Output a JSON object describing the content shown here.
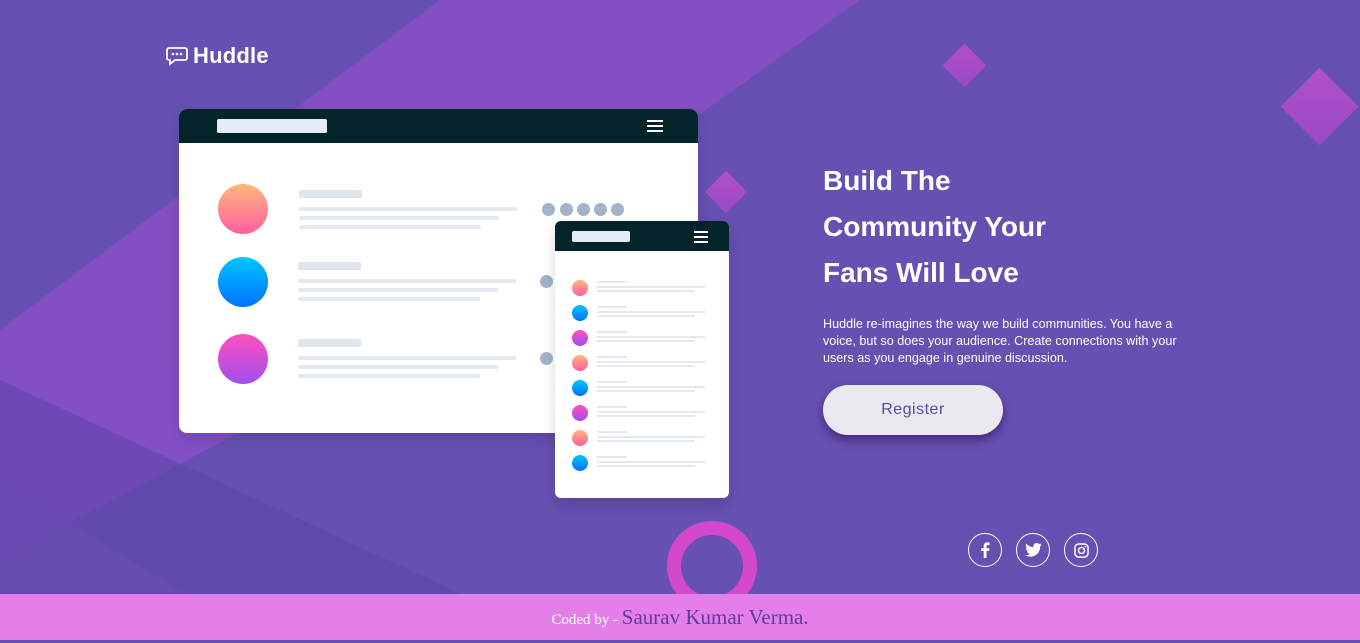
{
  "logo": {
    "text": "Huddle"
  },
  "hero": {
    "headline_lines": [
      "Build The",
      "Community Your",
      "Fans Will Love"
    ],
    "description": "Huddle re-imagines the way we build communities. You have a voice, but so does your audience. Create connections with your users as you engage in genuine discussion.",
    "register_label": "Register"
  },
  "social": [
    {
      "name": "facebook-icon"
    },
    {
      "name": "twitter-icon"
    },
    {
      "name": "instagram-icon"
    }
  ],
  "footer": {
    "prefix": "Coded by - ",
    "author": "Saurav Kumar Verma."
  },
  "colors": {
    "background": "#6650b2",
    "accent_pink": "#d449cc",
    "footer_bg": "#e47ee8",
    "mock_header": "#03242b",
    "button_bg": "#ebe9f0",
    "button_text": "#5b47a6"
  }
}
